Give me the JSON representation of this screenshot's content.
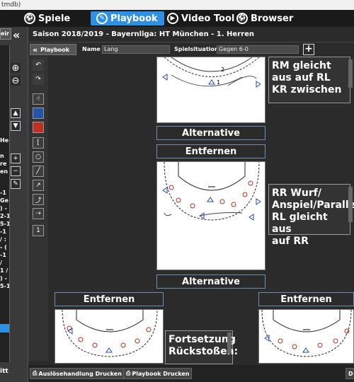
{
  "window": {
    "title": "tmdb)"
  },
  "nav": {
    "tabs": [
      {
        "label": "Spiele",
        "icon": "soccer-ball-icon"
      },
      {
        "label": "Playbook",
        "icon": "playbook-icon"
      },
      {
        "label": "Video Tool",
        "icon": "play-icon"
      },
      {
        "label": "Browser",
        "icon": "globe-icon"
      }
    ]
  },
  "leftpanel": {
    "lines": [
      "eir",
      "",
      "He",
      "n",
      "re",
      "en",
      "-1",
      "Ge",
      ") -",
      "2-1",
      "5-1",
      "-1",
      "/ :",
      "- (",
      "-1",
      "/ ",
      "1 /",
      ") -",
      "5-1"
    ],
    "bottom": "itt"
  },
  "header": {
    "text": "Saison 2018/2019 - Bayernliga:  HT München - 1. Herren"
  },
  "toolbar": {
    "playbook_label": "Playbook",
    "name_label": "Name",
    "name_value": "Lang",
    "situation_label": "Spielsituation",
    "situation_value": "Gegen 6-0",
    "plus_label": "+"
  },
  "tools": {
    "column_labels": [
      "[",
      "1"
    ],
    "side_plus": "+",
    "side_minus": "−"
  },
  "plays": [
    {
      "description": "RM gleicht aus auf RL\nKR zwischen",
      "alt": "Alternative",
      "remove": "Entfernen"
    },
    {
      "description": "RR Wurf/\nAnspiel/Parallel\nRL gleicht aus\nauf RR",
      "alt": "Alternative"
    }
  ],
  "bottom_row": {
    "left_remove": "Entfernen",
    "right_remove": "Entfernen",
    "middle_text": "Fortsetzung\nRückstoßen:"
  },
  "footer": {
    "print_trigger": "Auslösehandlung Drucken",
    "print_playbook": "Playbook Drucken",
    "right_stub": "D"
  },
  "colors": {
    "accent": "#2f8fe0",
    "background": "#2b2b2b"
  }
}
